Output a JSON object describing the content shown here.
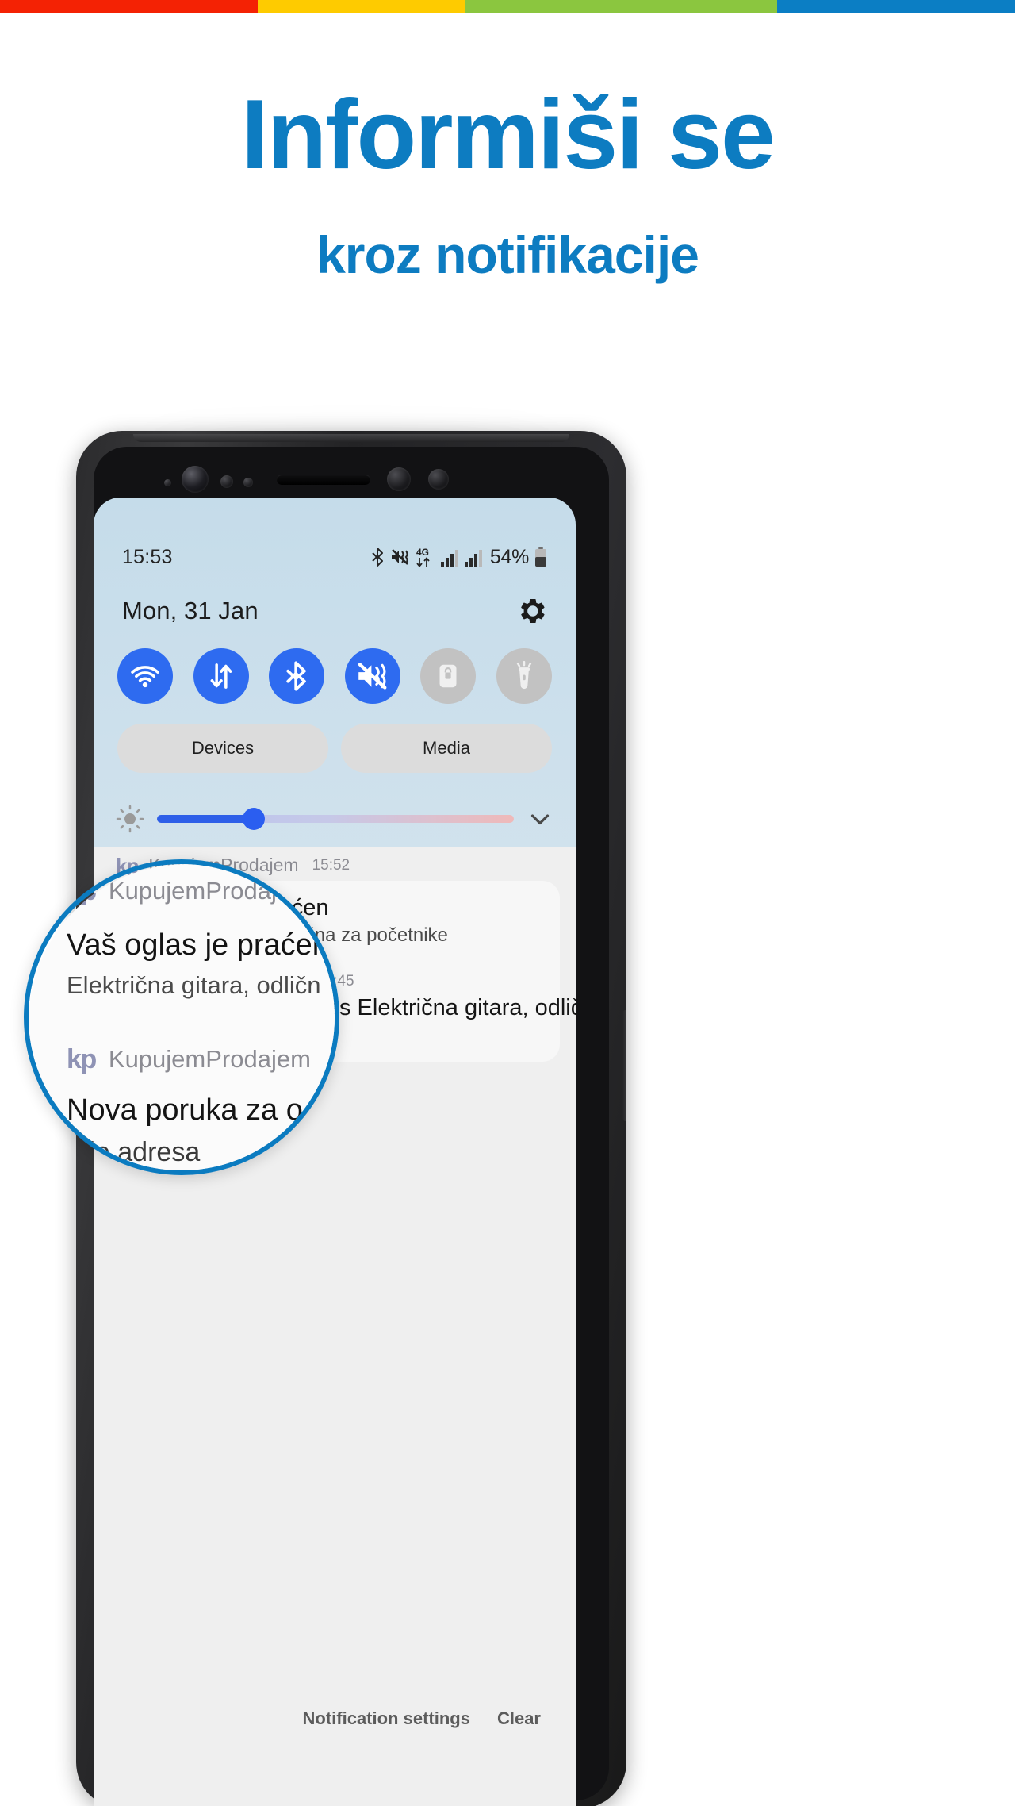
{
  "topbar": {
    "segments": [
      {
        "name": "red",
        "color": "#f42204"
      },
      {
        "name": "yellow",
        "color": "#fecb00"
      },
      {
        "name": "green",
        "color": "#8bc63f"
      },
      {
        "name": "blue",
        "color": "#0b7ec4"
      }
    ]
  },
  "promo": {
    "headline": "Informiši se",
    "subheadline": "kroz notifikacije",
    "accent_color": "#0d7cc1"
  },
  "phone": {
    "status_bar": {
      "time": "15:53",
      "battery_percent": "54%",
      "network_label": "4G",
      "icons": [
        "bluetooth-icon",
        "vibrate-icon",
        "4g-data-icon",
        "signal-bars-icon",
        "signal-bars-icon",
        "battery-icon"
      ]
    },
    "panel": {
      "date": "Mon, 31 Jan",
      "settings_icon": "gear-icon",
      "toggles": [
        {
          "name": "wifi",
          "icon": "wifi-icon",
          "state": "on"
        },
        {
          "name": "mobile-data",
          "icon": "data-arrows-icon",
          "state": "on"
        },
        {
          "name": "bluetooth",
          "icon": "bluetooth-icon",
          "state": "on"
        },
        {
          "name": "sound",
          "icon": "mute-icon",
          "state": "on"
        },
        {
          "name": "auto-rotate",
          "icon": "lock-rotate-icon",
          "state": "off"
        },
        {
          "name": "flashlight",
          "icon": "flashlight-icon",
          "state": "off"
        }
      ],
      "buttons": [
        {
          "name": "devices",
          "label": "Devices"
        },
        {
          "name": "media",
          "label": "Media"
        }
      ],
      "brightness": {
        "icon": "brightness-icon",
        "value_percent": 27,
        "expand_icon": "chevron-down-icon"
      }
    },
    "notifications": [
      {
        "app_logo": "kp",
        "app_name": "KupujemProdajem",
        "time": "15:52",
        "title": "Vaš oglas je praćen",
        "body": "Električna gitara, odlična za početnike"
      },
      {
        "app_logo": "kp",
        "app_name": "KupujemProdajem",
        "time": "1:45",
        "title": "Nova poruka za oglas Električna gitara, odlična..",
        "body": "Koja je adresa"
      }
    ],
    "footer": {
      "settings_label": "Notification settings",
      "clear_label": "Clear"
    }
  },
  "magnifier": {
    "border_color": "#0b7bc0",
    "items": [
      {
        "app_logo": "kp",
        "app_name": "KupujemProdajem",
        "title": "Vaš oglas je praćen",
        "body": "Električna gitara, odličn"
      },
      {
        "app_logo": "kp",
        "app_name": "KupujemProdajem",
        "title": "Nova poruka za o",
        "body": "a je adresa"
      }
    ]
  }
}
